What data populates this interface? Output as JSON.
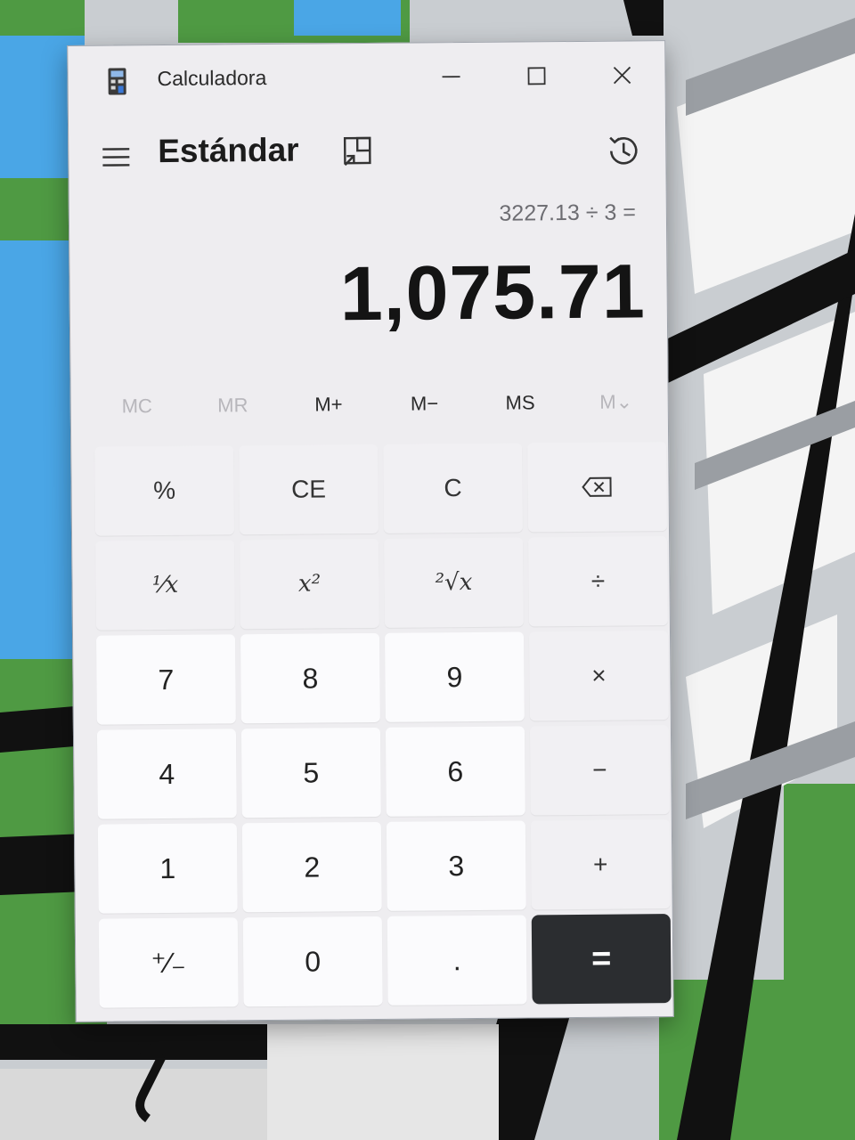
{
  "window": {
    "title": "Calculadora",
    "minimize_icon": "minimize-icon",
    "maximize_icon": "maximize-icon",
    "close_icon": "close-icon"
  },
  "header": {
    "mode": "Estándar",
    "menu_icon": "hamburger-icon",
    "keep_on_top_icon": "keep-on-top-icon",
    "history_icon": "history-icon"
  },
  "display": {
    "expression": "3227.13 ÷ 3 =",
    "result": "1,075.71"
  },
  "memory": [
    {
      "label": "MC",
      "enabled": false
    },
    {
      "label": "MR",
      "enabled": false
    },
    {
      "label": "M+",
      "enabled": true
    },
    {
      "label": "M−",
      "enabled": true
    },
    {
      "label": "MS",
      "enabled": true
    },
    {
      "label": "M⌄",
      "enabled": false
    }
  ],
  "keys": {
    "percent": "%",
    "ce": "CE",
    "c": "C",
    "backspace_icon": "backspace-icon",
    "reciprocal": "¹⁄x",
    "square": "x²",
    "sqrt": "²√x",
    "divide": "÷",
    "seven": "7",
    "eight": "8",
    "nine": "9",
    "multiply": "×",
    "four": "4",
    "five": "5",
    "six": "6",
    "minus": "−",
    "one": "1",
    "two": "2",
    "three": "3",
    "plus": "+",
    "negate": "⁺⁄₋",
    "zero": "0",
    "decimal": ".",
    "equals": "="
  },
  "colors": {
    "window_bg": "#eeedf0",
    "key_bg": "#f7f6f9",
    "equals_bg": "#2b2d30",
    "map_green": "#4f9a43",
    "map_water": "#4aa6e6",
    "map_road": "#111111"
  }
}
